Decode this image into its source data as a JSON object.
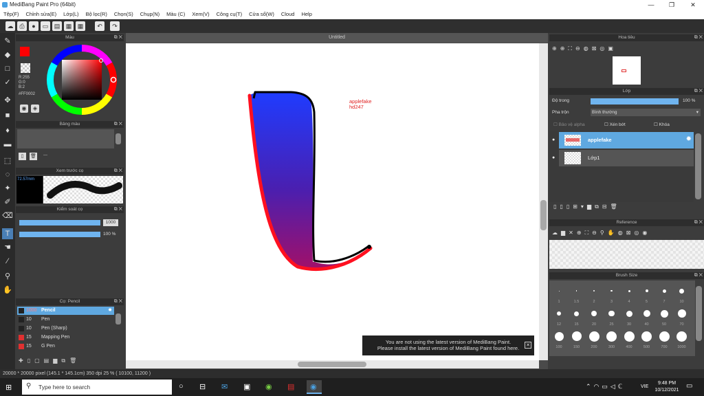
{
  "window": {
    "title": "MediBang Paint Pro (64bit)"
  },
  "menu": [
    "Tệp(F)",
    "Chỉnh sửa(E)",
    "Lớp(L)",
    "Bộ lọc(R)",
    "Chọn(S)",
    "Chụp(N)",
    "Màu (C)",
    "Xem(V)",
    "Công cụ(T)",
    "Cửa sổ(W)",
    "Cloud",
    "Help"
  ],
  "color_panel": {
    "title": "Màu",
    "r": "R:255",
    "g": "G:0",
    "b": "B:2",
    "hex": "#FF0002",
    "fg_color": "#ff0002",
    "bg_color": "#1a3cff"
  },
  "palette_panel": {
    "title": "Bảng màu",
    "dash": "---"
  },
  "preview_panel": {
    "title": "Xem trước cọ",
    "size": "72.57mm"
  },
  "brush_control": {
    "title": "Kiểm soát cọ",
    "size": "1000",
    "opacity": "100 %"
  },
  "brush_panel": {
    "title": "Cọ: Pencil",
    "items": [
      {
        "size": "1000",
        "name": "Pencil",
        "selected": true,
        "color": "#222222"
      },
      {
        "size": "10",
        "name": "Pen",
        "selected": false,
        "color": "#222222"
      },
      {
        "size": "10",
        "name": "Pen (Sharp)",
        "selected": false,
        "color": "#222222"
      },
      {
        "size": "15",
        "name": "Mapping Pen",
        "selected": false,
        "color": "#e03030"
      },
      {
        "size": "15",
        "name": "G Pen",
        "selected": false,
        "color": "#e03030"
      }
    ]
  },
  "canvas": {
    "tab": "Untitled",
    "text_line1": "applefake",
    "text_line2": "hd247"
  },
  "notice": {
    "line1": "You are not using the latest version of MediBang Paint.",
    "line2": "Please install the latest version of MediBang Paint found here.",
    "close": "✕"
  },
  "navigator_panel": {
    "title": "Hoa tiêu"
  },
  "layer_panel": {
    "title": "Lớp",
    "opacity_label": "Độ trong",
    "opacity_value": "100 %",
    "opacity_fraction": 1.0,
    "blend_label": "Pha trộn",
    "blend_value": "Bình thường",
    "protect_alpha": "Bảo vệ alpha",
    "clipping": "Xén bớt",
    "lock": "Khóa",
    "layers": [
      {
        "name": "applefake",
        "selected": true
      },
      {
        "name": "Lớp1",
        "selected": false
      }
    ]
  },
  "reference_panel": {
    "title": "Reference"
  },
  "brush_size_panel": {
    "title": "Brush Size",
    "sizes": [
      "1",
      "1.5",
      "2",
      "3",
      "4",
      "5",
      "7",
      "10",
      "12",
      "15",
      "20",
      "25",
      "30",
      "40",
      "50",
      "70",
      "100",
      "150",
      "200",
      "300",
      "400",
      "500",
      "700",
      "1000"
    ]
  },
  "status": {
    "text": "20000 * 20000 pixel  (145.1 * 145.1cm)  350 dpi  25 %  ( 10100, 11200 )"
  },
  "taskbar": {
    "search_placeholder": "Type here to search",
    "lang": "VIE",
    "time": "9:48 PM",
    "date": "10/12/2021"
  }
}
